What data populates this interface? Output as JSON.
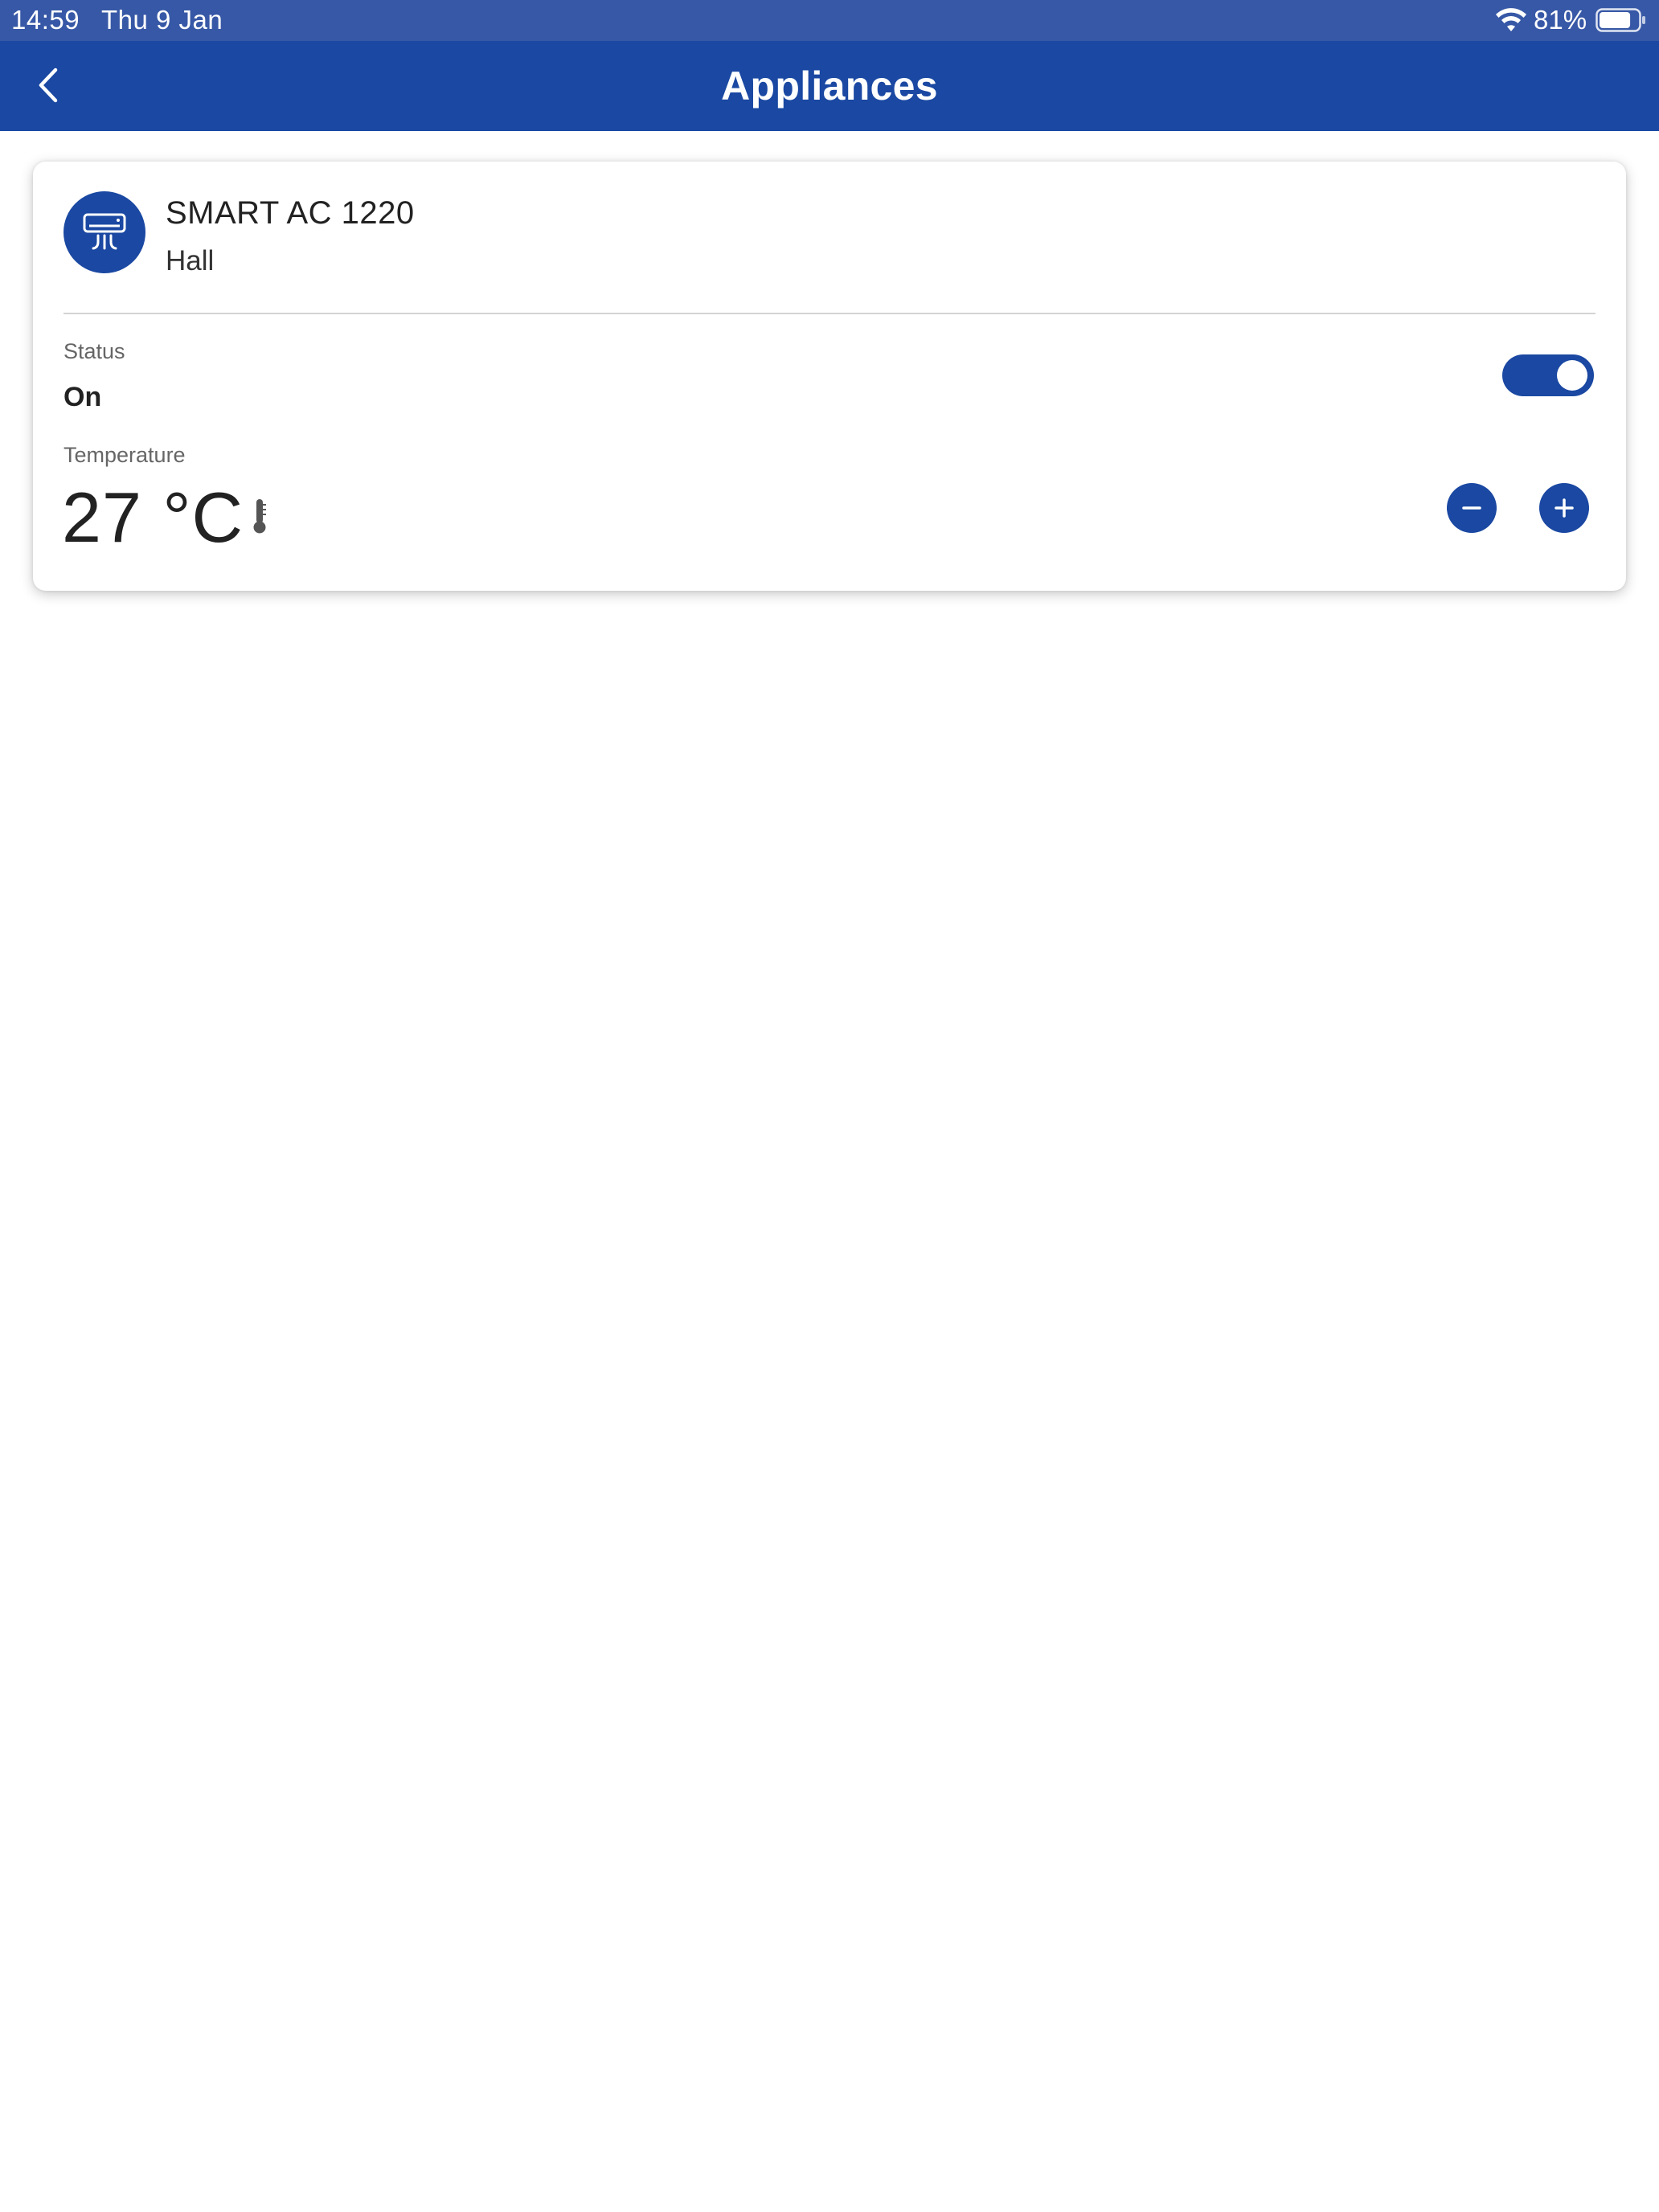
{
  "status_bar": {
    "time": "14:59",
    "date": "Thu 9 Jan",
    "battery_percent": "81%",
    "battery_level": 0.81,
    "wifi_icon": "wifi-icon",
    "battery_icon": "battery-icon"
  },
  "nav": {
    "title": "Appliances",
    "back_icon": "chevron-left-icon"
  },
  "device": {
    "icon": "air-conditioner-icon",
    "name": "SMART AC 1220",
    "room": "Hall",
    "status_label": "Status",
    "status_value": "On",
    "power_on": true,
    "temperature_label": "Temperature",
    "temperature_value": "27 °C",
    "thermometer_icon": "thermometer-icon",
    "decrease_icon": "minus-icon",
    "increase_icon": "plus-icon"
  },
  "colors": {
    "status_bar_bg": "#3758a6",
    "primary": "#1a48a2",
    "text": "#222222",
    "muted": "#666666",
    "divider": "#d4d4d4",
    "background": "#ffffff"
  }
}
